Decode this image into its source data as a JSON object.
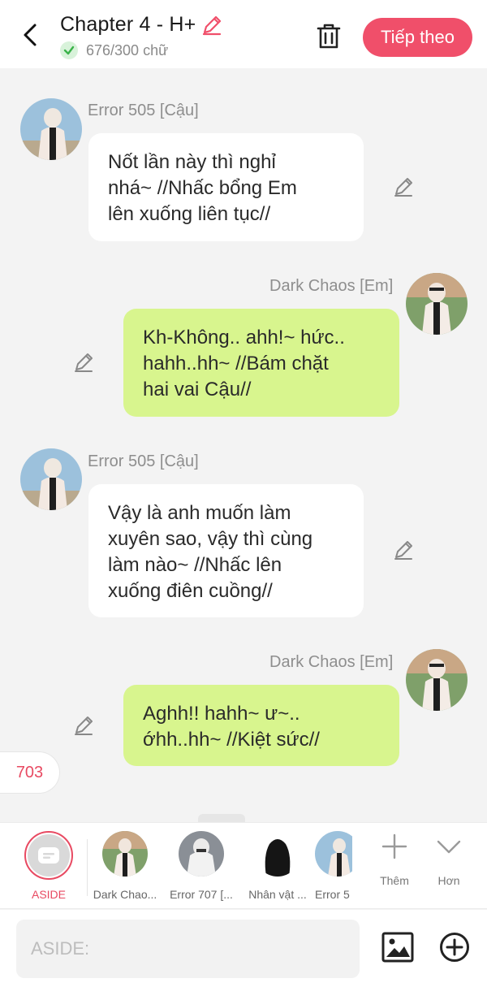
{
  "header": {
    "title": "Chapter 4 - H+",
    "word_count": "676/300 chữ",
    "next_label": "Tiếp theo",
    "accent_color": "#f04f6a"
  },
  "messages": [
    {
      "side": "left",
      "sender": "Error 505 [Cậu]",
      "lines": [
        "Nốt lần này thì nghỉ",
        "nhá~ //Nhấc bổng Em",
        "lên xuống liên tục//"
      ]
    },
    {
      "side": "right",
      "sender": "Dark Chaos [Em]",
      "lines": [
        "Kh-Không.. ahh!~ hức..",
        "hahh..hh~ //Bám chặt",
        "hai vai Cậu//"
      ]
    },
    {
      "side": "left",
      "sender": "Error 505 [Cậu]",
      "lines": [
        "Vậy là anh muốn làm",
        "xuyên sao, vậy thì cùng",
        "làm nào~ //Nhấc lên",
        "xuống điên cuồng//"
      ]
    },
    {
      "side": "right",
      "sender": "Dark Chaos [Em]",
      "lines": [
        "Aghh!! hahh~ ư~..",
        "ớhh..hh~ //Kiệt sức//"
      ]
    }
  ],
  "badge_count": "703",
  "character_bar": {
    "aside_label": "ASIDE",
    "characters": [
      "Dark Chao...",
      "Error 707 [...",
      "Nhân vật ...",
      "Error 5"
    ],
    "more_label": "Thêm",
    "collapse_label": "Hơn"
  },
  "input": {
    "placeholder": "ASIDE:"
  },
  "icons": [
    "back-arrow-icon",
    "pencil-icon",
    "check-icon",
    "trash-icon",
    "image-icon",
    "plus-circle-icon",
    "plus-icon",
    "chevron-down-icon"
  ]
}
